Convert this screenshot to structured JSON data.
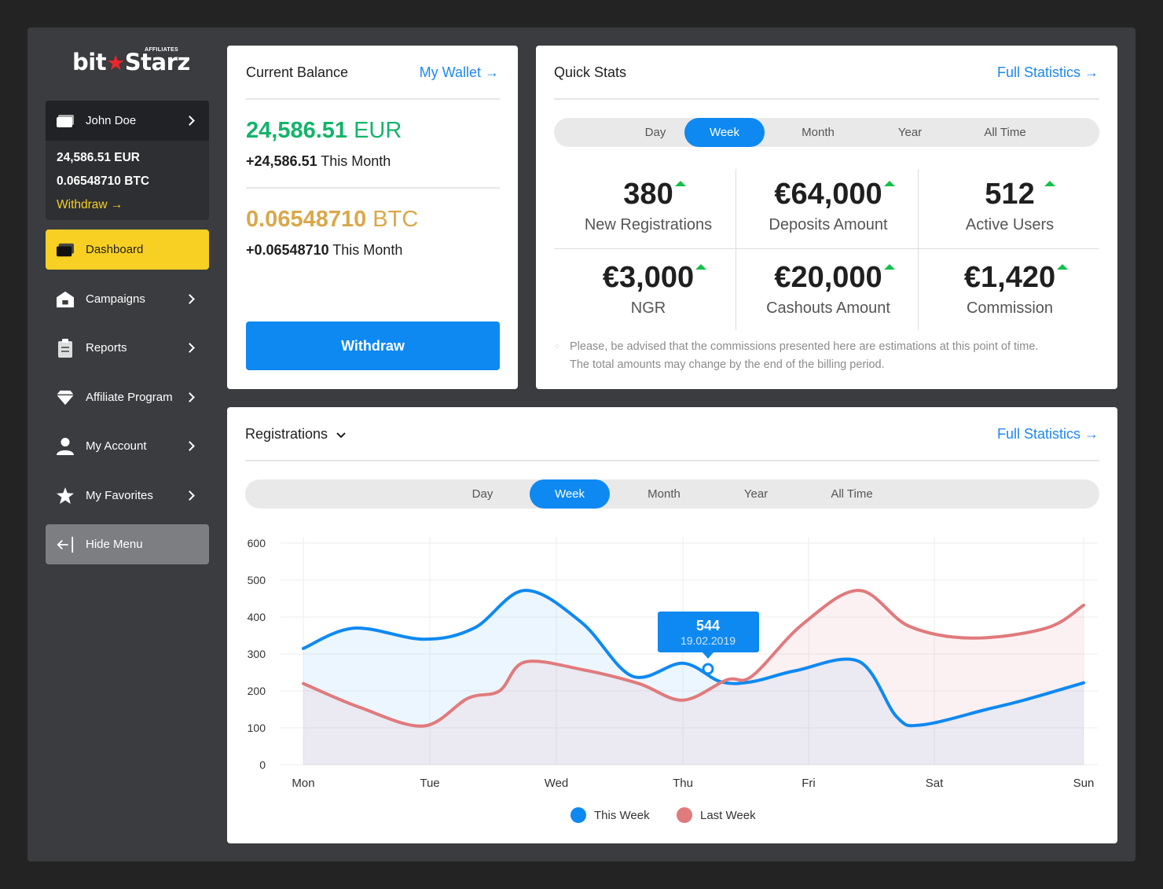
{
  "brand": {
    "name_left": "bit",
    "star": "★",
    "name_right": "Starz",
    "tagline": "AFFILIATES",
    "accent": "#e8262c"
  },
  "user": {
    "name": "John Doe",
    "eur": "24,586.51 EUR",
    "btc": "0.06548710 BTC",
    "withdraw_link": "Withdraw →"
  },
  "nav": [
    {
      "label": "Dashboard",
      "icon": "wallet-icon",
      "active": true
    },
    {
      "label": "Campaigns",
      "icon": "home-icon"
    },
    {
      "label": "Reports",
      "icon": "clipboard-icon"
    },
    {
      "label": "Affiliate Program",
      "icon": "diamond-icon"
    },
    {
      "label": "My Account",
      "icon": "user-icon"
    },
    {
      "label": "My Favorites",
      "icon": "star-icon"
    },
    {
      "label": "Hide Menu",
      "icon": "collapse-icon"
    }
  ],
  "balance": {
    "title": "Current Balance",
    "link": "My Wallet →",
    "eur_value": "24,586.51",
    "eur_unit": "EUR",
    "eur_month_value": "+24,586.51",
    "btc_value": "0.06548710",
    "btc_unit": "BTC",
    "btc_month_value": "+0.06548710",
    "month_suffix": "This Month",
    "withdraw_button": "Withdraw"
  },
  "quick_stats": {
    "title": "Quick Stats",
    "link": "Full Statistics →",
    "periods": [
      "Day",
      "Week",
      "Month",
      "Year",
      "All Time"
    ],
    "selected_period": "Week",
    "stats": [
      {
        "value": "380",
        "label": "New Registrations"
      },
      {
        "value": "€64,000",
        "label": "Deposits Amount"
      },
      {
        "value": "512",
        "label": "Active Users"
      },
      {
        "value": "€3,000",
        "label": "NGR"
      },
      {
        "value": "€20,000",
        "label": "Cashouts Amount"
      },
      {
        "value": "€1,420",
        "label": "Commission"
      }
    ],
    "note_line1": "Please, be advised that the commissions presented here are estimations at this point of time.",
    "note_line2": "The total amounts may change by the end of the billing period."
  },
  "registrations": {
    "title": "Registrations",
    "link": "Full Statistics →",
    "periods": [
      "Day",
      "Week",
      "Month",
      "Year",
      "All Time"
    ],
    "selected_period": "Week",
    "tooltip_value": "544",
    "tooltip_date": "19.02.2019"
  },
  "chart_data": {
    "type": "area",
    "x": [
      "Mon",
      "Tue",
      "Wed",
      "Thu",
      "Fri",
      "Sat",
      "Sun"
    ],
    "ylim": [
      0,
      600
    ],
    "yticks": [
      0,
      100,
      200,
      300,
      400,
      500,
      600
    ],
    "grid": true,
    "legend_position": "bottom",
    "series": [
      {
        "name": "This Week",
        "color": "#0e89f2",
        "points": [
          [
            0,
            315
          ],
          [
            0.4,
            370
          ],
          [
            0.95,
            340
          ],
          [
            1.35,
            370
          ],
          [
            1.75,
            472
          ],
          [
            2.2,
            385
          ],
          [
            2.6,
            240
          ],
          [
            3.0,
            275
          ],
          [
            3.3,
            225
          ],
          [
            3.55,
            225
          ],
          [
            3.9,
            255
          ],
          [
            4.4,
            280
          ],
          [
            4.7,
            130
          ],
          [
            4.9,
            108
          ],
          [
            5.35,
            150
          ],
          [
            5.6,
            175
          ],
          [
            6.0,
            222
          ]
        ]
      },
      {
        "name": "Last Week",
        "color": "#e07a7c",
        "points": [
          [
            0,
            220
          ],
          [
            0.45,
            155
          ],
          [
            0.95,
            105
          ],
          [
            1.3,
            180
          ],
          [
            1.55,
            200
          ],
          [
            1.75,
            278
          ],
          [
            2.2,
            258
          ],
          [
            2.65,
            220
          ],
          [
            3.0,
            175
          ],
          [
            3.35,
            230
          ],
          [
            3.55,
            240
          ],
          [
            3.95,
            380
          ],
          [
            4.4,
            472
          ],
          [
            4.8,
            375
          ],
          [
            5.25,
            343
          ],
          [
            5.75,
            370
          ],
          [
            6.0,
            432
          ]
        ]
      }
    ]
  }
}
